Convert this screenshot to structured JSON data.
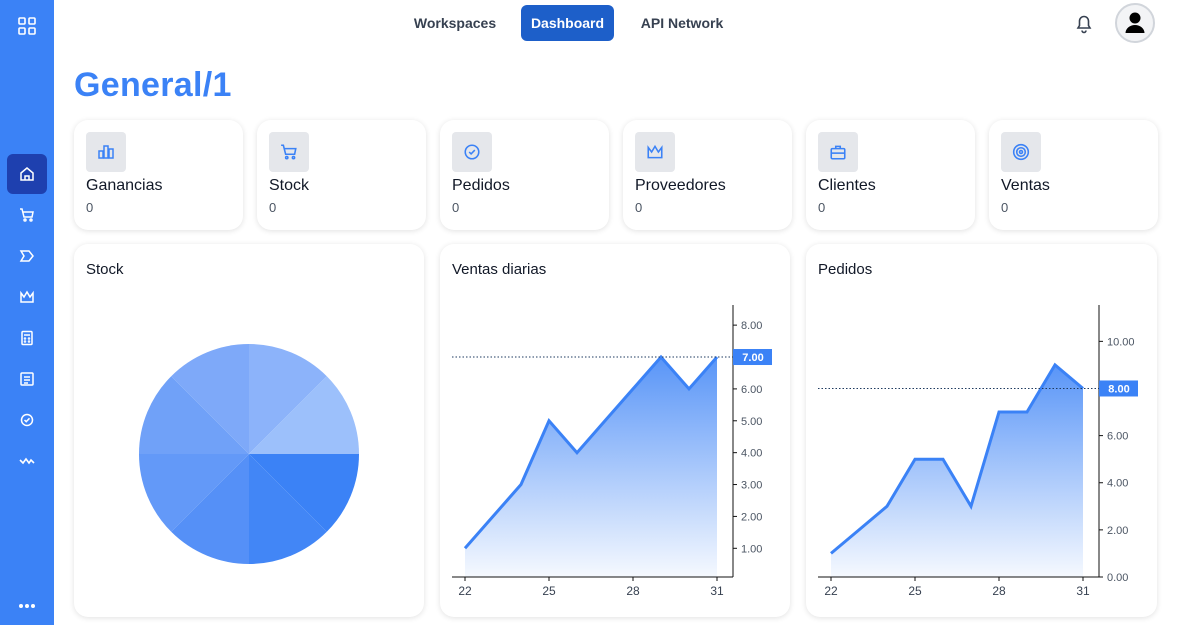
{
  "nav": {
    "items": [
      {
        "label": "Workspaces",
        "active": false
      },
      {
        "label": "Dashboard",
        "active": true
      },
      {
        "label": "API Network",
        "active": false
      }
    ]
  },
  "page": {
    "title": "General/1"
  },
  "sidebar": {
    "icons": [
      "grid-icon",
      "home-icon",
      "cart-icon",
      "tag-icon",
      "crown-icon",
      "calculator-icon",
      "list-icon",
      "badge-check-icon",
      "activity-icon",
      "more-icon"
    ]
  },
  "stats": [
    {
      "label": "Ganancias",
      "value": "0",
      "icon": "bar-chart-icon"
    },
    {
      "label": "Stock",
      "value": "0",
      "icon": "cart-icon"
    },
    {
      "label": "Pedidos",
      "value": "0",
      "icon": "badge-check-icon"
    },
    {
      "label": "Proveedores",
      "value": "0",
      "icon": "crown-icon"
    },
    {
      "label": "Clientes",
      "value": "0",
      "icon": "briefcase-icon"
    },
    {
      "label": "Ventas",
      "value": "0",
      "icon": "target-icon"
    }
  ],
  "colors": {
    "accent": "#3b82f6",
    "sidebar": "#3b82f6",
    "active_nav": "#1d5fc9"
  },
  "chart_data": [
    {
      "type": "pie",
      "title": "Stock",
      "values": [
        15,
        15,
        15,
        15,
        15,
        15,
        15,
        15
      ],
      "colors": [
        "#3b82f6",
        "#4286f6",
        "#5590f7",
        "#6399f8",
        "#70a1f8",
        "#7ea9f9",
        "#8cb3fa",
        "#9cc0fb"
      ]
    },
    {
      "type": "area",
      "title": "Ventas diarias",
      "x": [
        22,
        23,
        24,
        25,
        26,
        27,
        28,
        29,
        30,
        31
      ],
      "values": [
        1,
        2,
        3,
        5,
        4,
        5,
        6,
        7,
        6,
        7
      ],
      "xticks": [
        22,
        25,
        28,
        31
      ],
      "yticks": [
        "1.00",
        "2.00",
        "3.00",
        "4.00",
        "5.00",
        "6.00",
        "7.00",
        "8.00"
      ],
      "ylim": [
        0.1,
        8.6
      ],
      "current_label": "7.00",
      "current_value": 7
    },
    {
      "type": "area",
      "title": "Pedidos",
      "x": [
        22,
        23,
        24,
        25,
        26,
        27,
        28,
        29,
        30,
        31
      ],
      "values": [
        1,
        2,
        3,
        5,
        5,
        3,
        7,
        7,
        9,
        8
      ],
      "xticks": [
        22,
        25,
        28,
        31
      ],
      "yticks": [
        "0.00",
        "2.00",
        "4.00",
        "6.00",
        "8.00",
        "10.00"
      ],
      "ylim": [
        0,
        11.5
      ],
      "current_label": "8.00",
      "current_value": 8
    }
  ]
}
